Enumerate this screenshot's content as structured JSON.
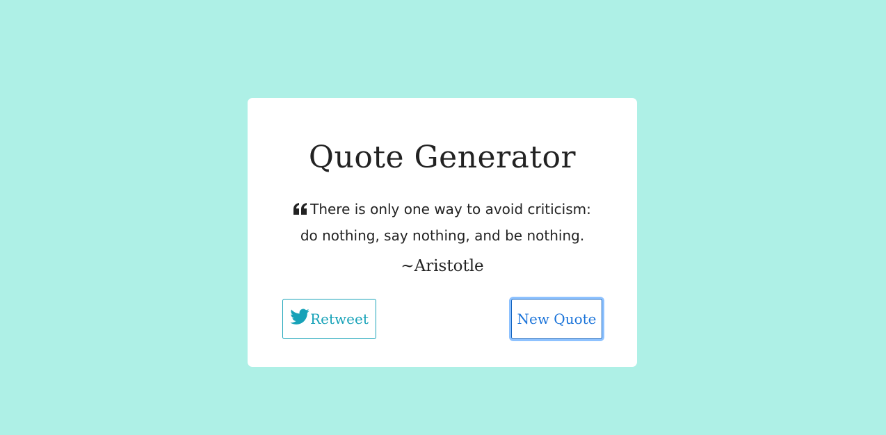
{
  "app": {
    "title": "Quote Generator"
  },
  "quote": {
    "text": "There is only one way to avoid criticism: do nothing, say nothing, and be nothing.",
    "author": "~Aristotle",
    "icon": "quote-left-icon"
  },
  "buttons": {
    "retweet_label": "Retweet",
    "retweet_icon": "twitter-icon",
    "new_quote_label": "New Quote"
  },
  "colors": {
    "background": "#aef0e6",
    "card": "#ffffff",
    "retweet_accent": "#17a2b8",
    "new_quote_accent": "#1a73d9",
    "focus_ring": "#8ec2ff"
  }
}
